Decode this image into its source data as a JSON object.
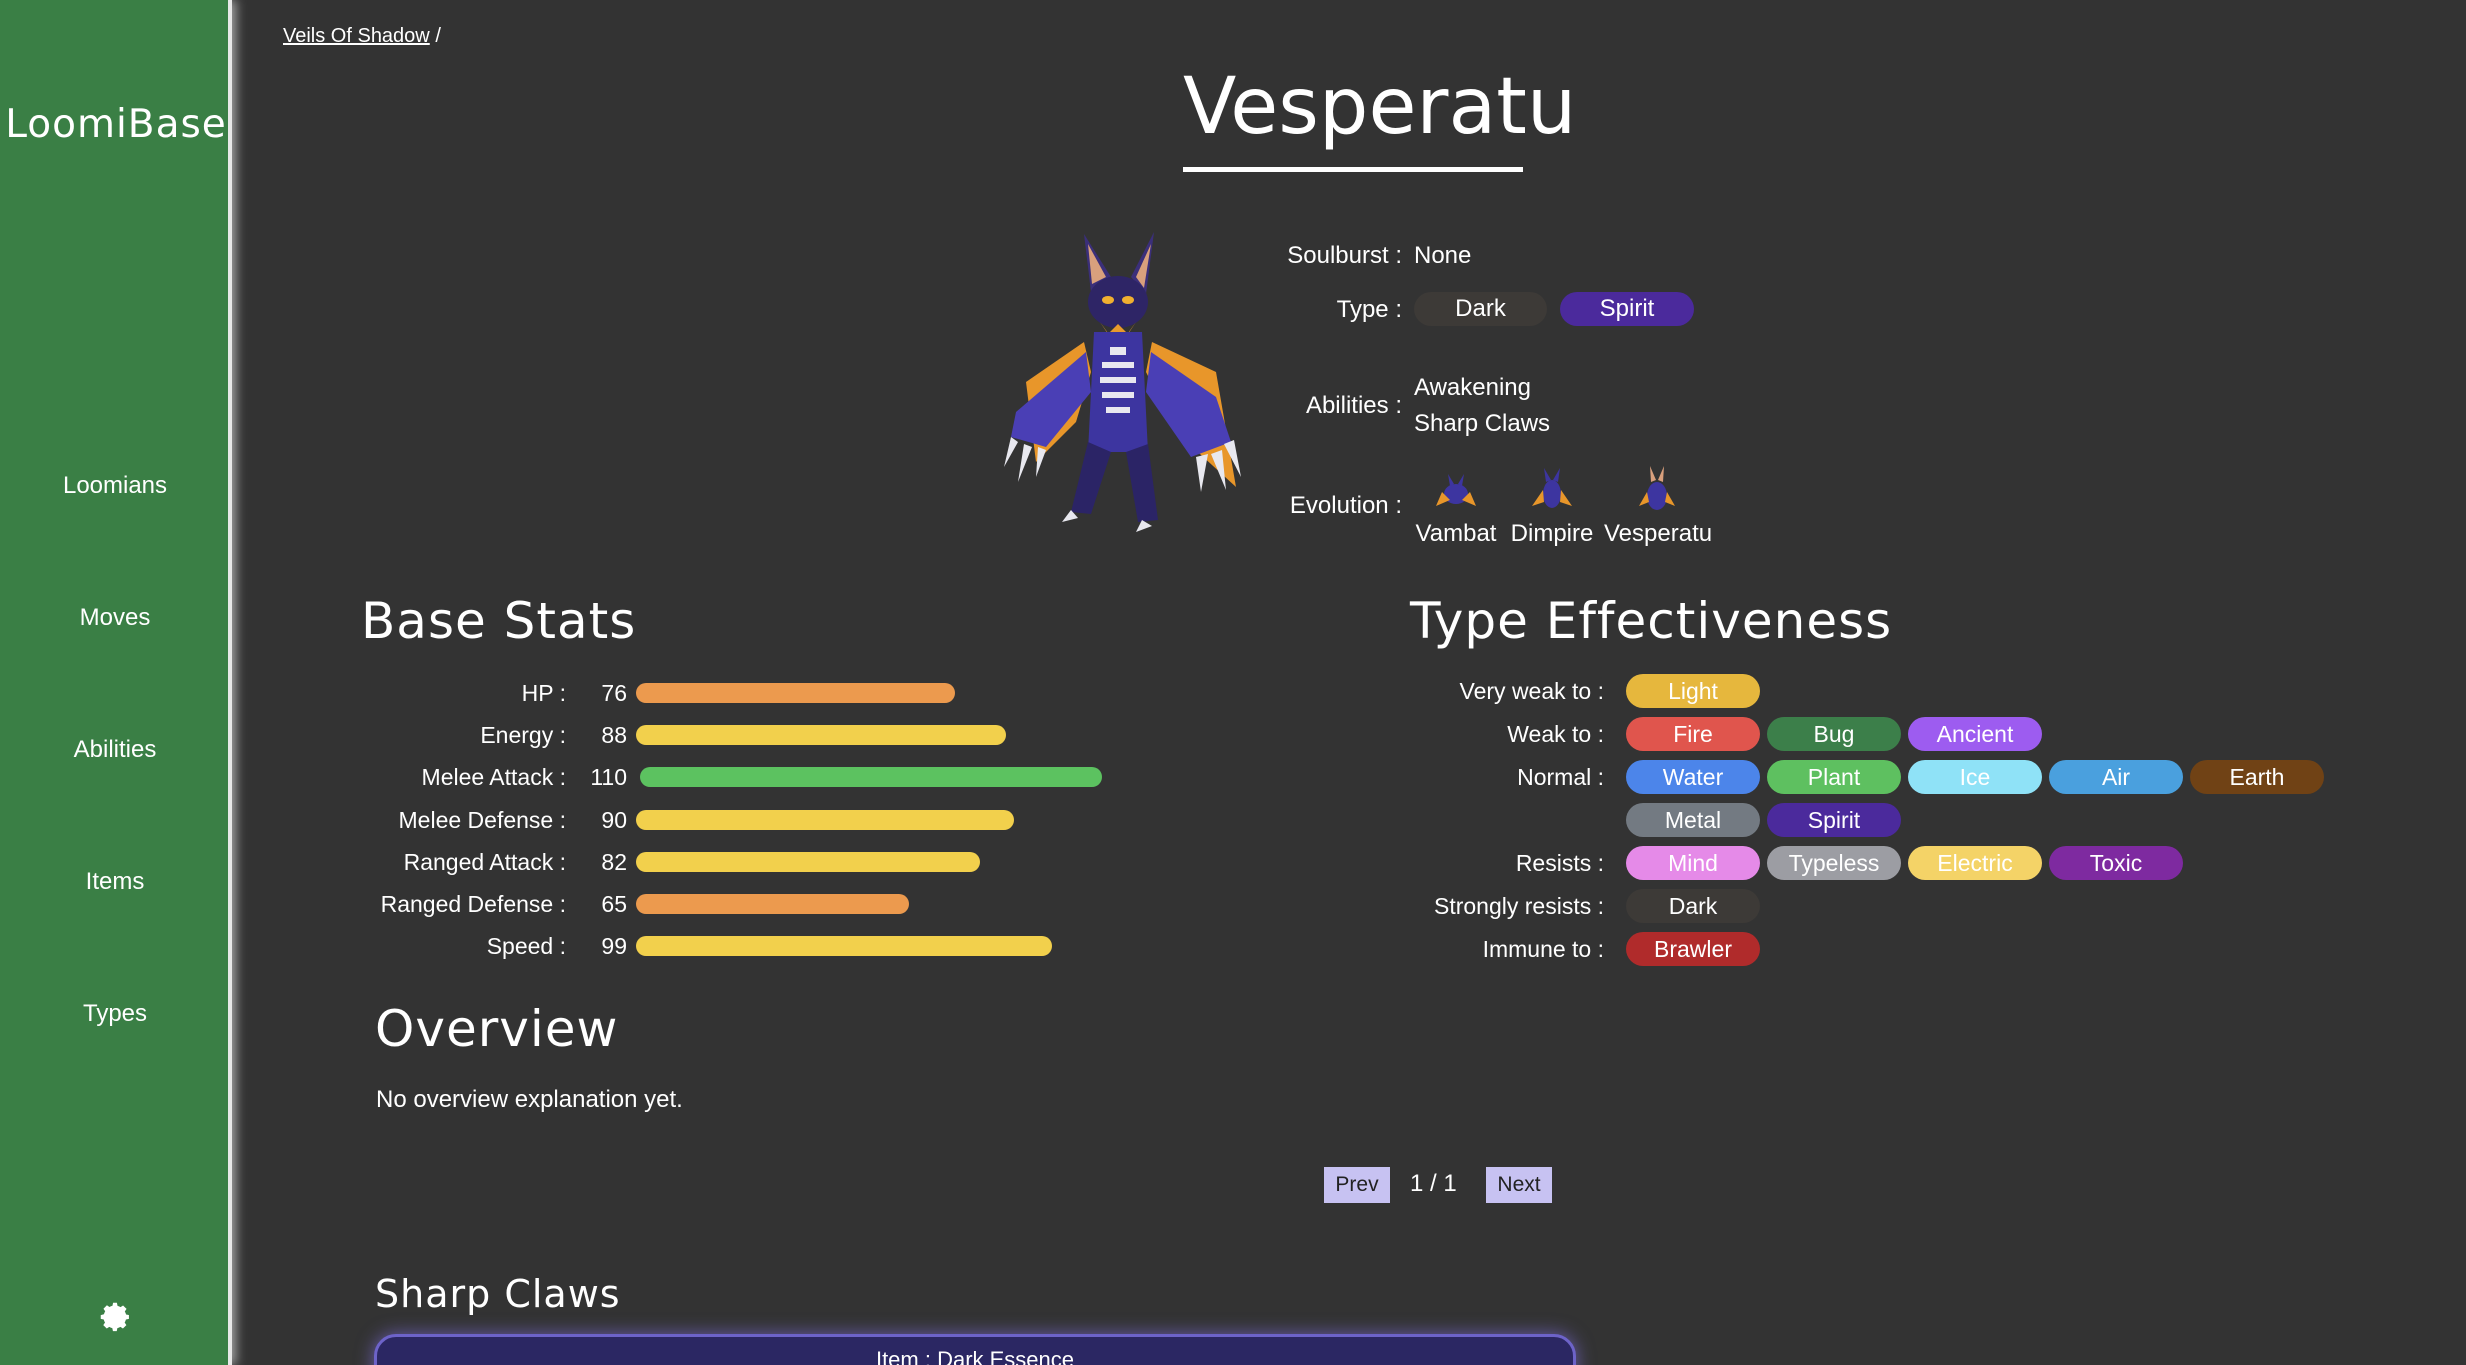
{
  "sidebar": {
    "logo": "LoomiBase",
    "items": [
      {
        "label": "Loomians"
      },
      {
        "label": "Moves"
      },
      {
        "label": "Abilities"
      },
      {
        "label": "Items"
      },
      {
        "label": "Types"
      }
    ],
    "settings_icon": "gear-icon",
    "color": "#3a7f45"
  },
  "breadcrumb": {
    "link": "Veils Of Shadow",
    "separator": "/"
  },
  "title": "Vesperatu",
  "info": {
    "soulburst_label": "Soulburst :",
    "soulburst_value": "None",
    "type_label": "Type :",
    "types": [
      {
        "name": "Dark",
        "color": "#3d3a37"
      },
      {
        "name": "Spirit",
        "color": "#4b2a9c"
      }
    ],
    "abilities_label": "Abilities :",
    "abilities": [
      "Awakening",
      "Sharp Claws"
    ],
    "evolution_label": "Evolution :",
    "evolution": [
      "Vambat",
      "Dimpire",
      "Vesperatu"
    ]
  },
  "base_stats": {
    "heading": "Base Stats",
    "stats": [
      {
        "label": "HP :",
        "value": 76,
        "color": "#ec9a4e"
      },
      {
        "label": "Energy :",
        "value": 88,
        "color": "#f2d04c"
      },
      {
        "label": "Melee Attack :",
        "value": 110,
        "color": "#5cc260"
      },
      {
        "label": "Melee Defense :",
        "value": 90,
        "color": "#f2d04c"
      },
      {
        "label": "Ranged Attack :",
        "value": 82,
        "color": "#f2d04c"
      },
      {
        "label": "Ranged Defense :",
        "value": 65,
        "color": "#ec9a4e"
      },
      {
        "label": "Speed :",
        "value": 99,
        "color": "#f2d04c"
      }
    ]
  },
  "type_effectiveness": {
    "heading": "Type Effectiveness",
    "rows": [
      {
        "label": "Very weak to :",
        "types": [
          {
            "name": "Light",
            "color": "#e6b73d"
          }
        ]
      },
      {
        "label": "Weak to :",
        "types": [
          {
            "name": "Fire",
            "color": "#e0554d"
          },
          {
            "name": "Bug",
            "color": "#3c7f4a"
          },
          {
            "name": "Ancient",
            "color": "#9d5cf0"
          }
        ]
      },
      {
        "label": "Normal :",
        "types": [
          {
            "name": "Water",
            "color": "#4c85ea"
          },
          {
            "name": "Plant",
            "color": "#5ec060"
          },
          {
            "name": "Ice",
            "color": "#8fe2f7"
          },
          {
            "name": "Air",
            "color": "#4aa0de"
          },
          {
            "name": "Earth",
            "color": "#704215"
          },
          {
            "name": "Metal",
            "color": "#737a82"
          },
          {
            "name": "Spirit",
            "color": "#4b2a9c"
          }
        ]
      },
      {
        "label": "Resists :",
        "types": [
          {
            "name": "Mind",
            "color": "#e58ae8"
          },
          {
            "name": "Typeless",
            "color": "#9c9da3"
          },
          {
            "name": "Electric",
            "color": "#f4d367"
          },
          {
            "name": "Toxic",
            "color": "#7e2aa0"
          }
        ]
      },
      {
        "label": "Strongly resists :",
        "types": [
          {
            "name": "Dark",
            "color": "#3d3a37"
          }
        ]
      },
      {
        "label": "Immune to :",
        "types": [
          {
            "name": "Brawler",
            "color": "#b02b2b"
          }
        ]
      }
    ]
  },
  "overview": {
    "heading": "Overview",
    "text": "No overview explanation yet.",
    "prev": "Prev",
    "next": "Next",
    "page": "1 / 1"
  },
  "ability_section": {
    "heading": "Sharp Claws",
    "card_text": "Item : Dark Essence"
  }
}
